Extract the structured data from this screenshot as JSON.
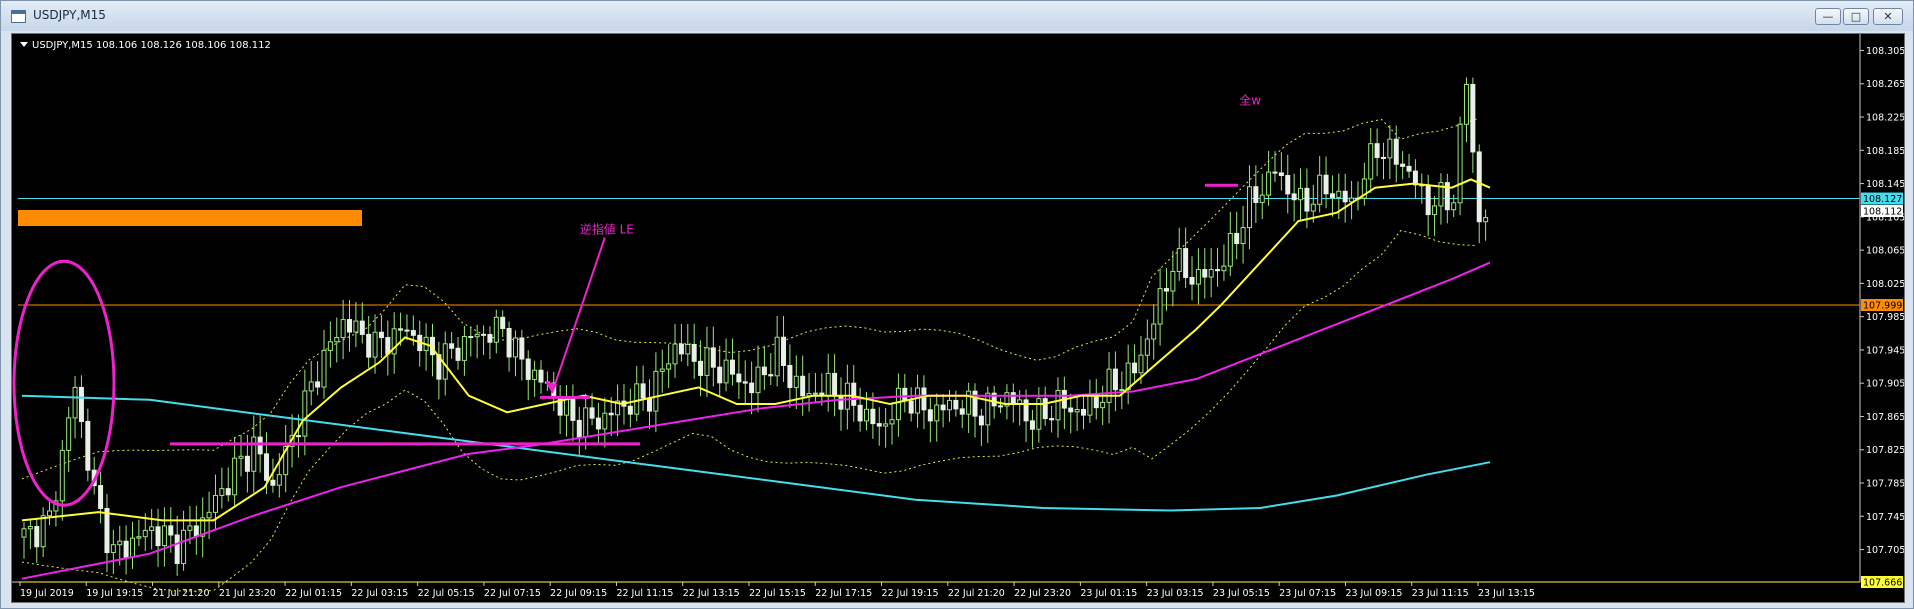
{
  "window": {
    "title": "USDJPY,M15",
    "buttons": {
      "minimize": "—",
      "maximize": "□",
      "close": "✕"
    },
    "icon": "chart-window-icon"
  },
  "chart_data": {
    "type": "candlestick",
    "header": "USDJPY,M15  108.106 108.126 108.106 108.112",
    "colors": {
      "background": "#000000",
      "up_candle": "#9AE87A",
      "down_candle": "#E8F0E8",
      "sma_fast": "#FFFF33",
      "sma_mid": "#EE22EE",
      "sma_slow": "#44DDEE",
      "bands": "#E8E840",
      "annotation": "#EE22CC",
      "orange_marker": "#FF8C00",
      "axis_text": "#FFFFFF"
    },
    "ylim": [
      107.666,
      108.32
    ],
    "y_ticks": [
      "108.305",
      "108.265",
      "108.225",
      "108.185",
      "108.145",
      "108.105",
      "108.065",
      "108.025",
      "107.985",
      "107.945",
      "107.905",
      "107.865",
      "107.825",
      "107.785",
      "107.745",
      "107.705"
    ],
    "x_ticks": [
      "19 Jul 2019",
      "19 Jul 19:15",
      "21 Jul 21:20",
      "21 Jul 23:20",
      "22 Jul 01:15",
      "22 Jul 03:15",
      "22 Jul 05:15",
      "22 Jul 07:15",
      "22 Jul 09:15",
      "22 Jul 11:15",
      "22 Jul 13:15",
      "22 Jul 15:15",
      "22 Jul 17:15",
      "22 Jul 19:15",
      "22 Jul 21:20",
      "22 Jul 23:20",
      "23 Jul 01:15",
      "23 Jul 03:15",
      "23 Jul 05:15",
      "23 Jul 07:15",
      "23 Jul 09:15",
      "23 Jul 11:15",
      "23 Jul 13:15"
    ],
    "price_labels": [
      {
        "value": 108.127,
        "text": "108.127",
        "color": "#44DDEE"
      },
      {
        "value": 108.112,
        "text": "108.112",
        "color": "#FFFFFF"
      },
      {
        "value": 107.999,
        "text": "107.999",
        "color": "#FF8C00"
      },
      {
        "value": 107.666,
        "text": "107.666",
        "color": "#FFFF33"
      }
    ],
    "hlines": [
      {
        "value": 108.127,
        "color": "#44DDEE"
      },
      {
        "value": 107.999,
        "color": "#FF8C00"
      },
      {
        "value": 107.666,
        "color": "#FFFF33"
      }
    ],
    "annotations": [
      {
        "text": "逆指値 LE",
        "x": 0.305,
        "value": 108.085,
        "color": "#EE22CC"
      },
      {
        "text": "全w",
        "x": 0.663,
        "value": 108.24,
        "color": "#EE22CC"
      }
    ],
    "bar_count": 230,
    "close_path": [
      [
        0,
        107.72
      ],
      [
        4,
        107.74
      ],
      [
        8,
        107.9
      ],
      [
        11,
        107.77
      ],
      [
        14,
        107.7
      ],
      [
        20,
        107.73
      ],
      [
        24,
        107.71
      ],
      [
        28,
        107.74
      ],
      [
        33,
        107.8
      ],
      [
        36,
        107.83
      ],
      [
        39,
        107.78
      ],
      [
        42,
        107.84
      ],
      [
        46,
        107.92
      ],
      [
        50,
        107.98
      ],
      [
        55,
        107.95
      ],
      [
        60,
        107.97
      ],
      [
        65,
        107.93
      ],
      [
        70,
        107.96
      ],
      [
        75,
        107.97
      ],
      [
        78,
        107.93
      ],
      [
        82,
        107.9
      ],
      [
        86,
        107.86
      ],
      [
        90,
        107.86
      ],
      [
        94,
        107.88
      ],
      [
        98,
        107.89
      ],
      [
        102,
        107.95
      ],
      [
        106,
        107.93
      ],
      [
        110,
        107.92
      ],
      [
        114,
        107.9
      ],
      [
        118,
        107.94
      ],
      [
        122,
        107.89
      ],
      [
        126,
        107.9
      ],
      [
        130,
        107.88
      ],
      [
        134,
        107.85
      ],
      [
        138,
        107.89
      ],
      [
        142,
        107.87
      ],
      [
        146,
        107.88
      ],
      [
        150,
        107.87
      ],
      [
        154,
        107.89
      ],
      [
        158,
        107.86
      ],
      [
        162,
        107.88
      ],
      [
        166,
        107.87
      ],
      [
        170,
        107.9
      ],
      [
        174,
        107.92
      ],
      [
        177,
        107.98
      ],
      [
        180,
        108.05
      ],
      [
        184,
        108.03
      ],
      [
        188,
        108.05
      ],
      [
        192,
        108.12
      ],
      [
        196,
        108.16
      ],
      [
        200,
        108.12
      ],
      [
        204,
        108.14
      ],
      [
        208,
        108.12
      ],
      [
        212,
        108.19
      ],
      [
        216,
        108.17
      ],
      [
        220,
        108.12
      ],
      [
        224,
        108.13
      ],
      [
        226,
        108.27
      ],
      [
        228,
        108.1
      ],
      [
        230,
        108.11
      ]
    ],
    "sma_fast": [
      [
        0,
        107.74
      ],
      [
        12,
        107.75
      ],
      [
        22,
        107.74
      ],
      [
        30,
        107.74
      ],
      [
        38,
        107.78
      ],
      [
        44,
        107.86
      ],
      [
        50,
        107.9
      ],
      [
        56,
        107.93
      ],
      [
        60,
        107.96
      ],
      [
        64,
        107.95
      ],
      [
        70,
        107.89
      ],
      [
        76,
        107.87
      ],
      [
        82,
        107.88
      ],
      [
        88,
        107.89
      ],
      [
        94,
        107.88
      ],
      [
        100,
        107.89
      ],
      [
        106,
        107.9
      ],
      [
        112,
        107.88
      ],
      [
        118,
        107.88
      ],
      [
        124,
        107.89
      ],
      [
        130,
        107.89
      ],
      [
        136,
        107.88
      ],
      [
        142,
        107.89
      ],
      [
        148,
        107.89
      ],
      [
        154,
        107.88
      ],
      [
        160,
        107.88
      ],
      [
        166,
        107.89
      ],
      [
        172,
        107.89
      ],
      [
        178,
        107.93
      ],
      [
        184,
        107.97
      ],
      [
        188,
        108.0
      ],
      [
        194,
        108.05
      ],
      [
        200,
        108.1
      ],
      [
        206,
        108.11
      ],
      [
        212,
        108.14
      ],
      [
        218,
        108.145
      ],
      [
        224,
        108.14
      ],
      [
        227,
        108.15
      ],
      [
        230,
        108.14
      ]
    ],
    "sma_mid": [
      [
        0,
        107.67
      ],
      [
        20,
        107.7
      ],
      [
        36,
        107.745
      ],
      [
        50,
        107.78
      ],
      [
        60,
        107.8
      ],
      [
        70,
        107.82
      ],
      [
        80,
        107.83
      ],
      [
        92,
        107.845
      ],
      [
        104,
        107.86
      ],
      [
        116,
        107.875
      ],
      [
        128,
        107.885
      ],
      [
        140,
        107.89
      ],
      [
        152,
        107.89
      ],
      [
        164,
        107.89
      ],
      [
        174,
        107.895
      ],
      [
        184,
        107.91
      ],
      [
        194,
        107.94
      ],
      [
        204,
        107.97
      ],
      [
        214,
        108.0
      ],
      [
        224,
        108.03
      ],
      [
        230,
        108.05
      ]
    ],
    "sma_slow": [
      [
        0,
        107.89
      ],
      [
        20,
        107.885
      ],
      [
        40,
        107.865
      ],
      [
        60,
        107.845
      ],
      [
        80,
        107.825
      ],
      [
        100,
        107.805
      ],
      [
        120,
        107.785
      ],
      [
        140,
        107.765
      ],
      [
        160,
        107.755
      ],
      [
        180,
        107.752
      ],
      [
        194,
        107.755
      ],
      [
        206,
        107.77
      ],
      [
        220,
        107.795
      ],
      [
        230,
        107.81
      ]
    ]
  }
}
